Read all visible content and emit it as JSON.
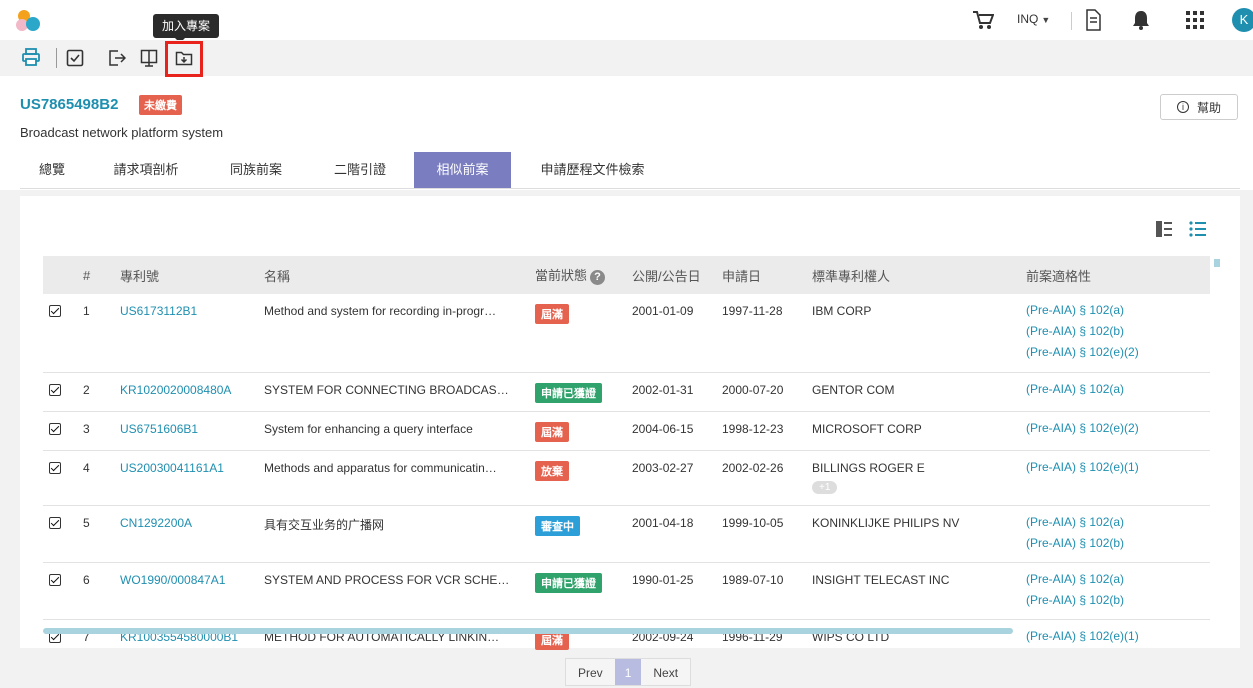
{
  "topbar": {
    "tooltip": "加入專案",
    "inq_label": "INQ",
    "avatar_letter": "K"
  },
  "patent": {
    "id": "US7865498B2",
    "fee_badge": "未繳費",
    "title": "Broadcast network platform system",
    "help_label": "幫助"
  },
  "tabs": [
    {
      "label": "總覽"
    },
    {
      "label": "請求項剖析"
    },
    {
      "label": "同族前案"
    },
    {
      "label": "二階引證"
    },
    {
      "label": "相似前案",
      "active": true
    },
    {
      "label": "申請歷程文件檢索"
    }
  ],
  "table": {
    "headers": {
      "num": "#",
      "patent_no": "專利號",
      "name": "名稱",
      "status": "當前狀態",
      "pub_date": "公開/公告日",
      "app_date": "申請日",
      "assignee": "標準專利權人",
      "suitability": "前案適格性"
    },
    "rows": [
      {
        "num": "1",
        "patent_no": "US6173112B1",
        "name": "Method and system for recording in-progr…",
        "status": "屆滿",
        "status_color": "#e5624f",
        "pub_date": "2001-01-09",
        "app_date": "1997-11-28",
        "assignee": "IBM CORP",
        "more": "",
        "suitability": [
          "(Pre-AIA) § 102(a)",
          "(Pre-AIA) § 102(b)",
          "(Pre-AIA) § 102(e)(2)"
        ]
      },
      {
        "num": "2",
        "patent_no": "KR1020020008480A",
        "name": "SYSTEM FOR CONNECTING BROADCAS…",
        "status": "申請已獲證",
        "status_color": "#2fa36b",
        "pub_date": "2002-01-31",
        "app_date": "2000-07-20",
        "assignee": "GENTOR COM",
        "more": "",
        "suitability": [
          "(Pre-AIA) § 102(a)"
        ]
      },
      {
        "num": "3",
        "patent_no": "US6751606B1",
        "name": "System for enhancing a query interface",
        "status": "屆滿",
        "status_color": "#e5624f",
        "pub_date": "2004-06-15",
        "app_date": "1998-12-23",
        "assignee": "MICROSOFT CORP",
        "more": "",
        "suitability": [
          "(Pre-AIA) § 102(e)(2)"
        ]
      },
      {
        "num": "4",
        "patent_no": "US20030041161A1",
        "name": "Methods and apparatus for communicatin…",
        "status": "放棄",
        "status_color": "#e5624f",
        "pub_date": "2003-02-27",
        "app_date": "2002-02-26",
        "assignee": "BILLINGS ROGER E",
        "more": "+1",
        "suitability": [
          "(Pre-AIA) § 102(e)(1)"
        ]
      },
      {
        "num": "5",
        "patent_no": "CN1292200A",
        "name": "具有交互业务的广播网",
        "status": "審查中",
        "status_color": "#2d9fd8",
        "pub_date": "2001-04-18",
        "app_date": "1999-10-05",
        "assignee": "KONINKLIJKE PHILIPS NV",
        "more": "",
        "suitability": [
          "(Pre-AIA) § 102(a)",
          "(Pre-AIA) § 102(b)"
        ]
      },
      {
        "num": "6",
        "patent_no": "WO1990/000847A1",
        "name": "SYSTEM AND PROCESS FOR VCR SCHE…",
        "status": "申請已獲證",
        "status_color": "#2fa36b",
        "pub_date": "1990-01-25",
        "app_date": "1989-07-10",
        "assignee": "INSIGHT TELECAST INC",
        "more": "",
        "suitability": [
          "(Pre-AIA) § 102(a)",
          "(Pre-AIA) § 102(b)"
        ]
      },
      {
        "num": "7",
        "patent_no": "KR1003554580000B1",
        "name": "METHOD FOR AUTOMATICALLY LINKIN…",
        "status": "屆滿",
        "status_color": "#e5624f",
        "pub_date": "2002-09-24",
        "app_date": "1996-11-29",
        "assignee": "WIPS CO LTD",
        "more": "",
        "suitability": [
          "(Pre-AIA) § 102(e)(1)"
        ]
      }
    ]
  },
  "pager": {
    "prev": "Prev",
    "current": "1",
    "next": "Next"
  },
  "colors": {
    "accent": "#1f8fb0",
    "tab_active": "#7a7dbf",
    "highlight": "#e8231c"
  }
}
